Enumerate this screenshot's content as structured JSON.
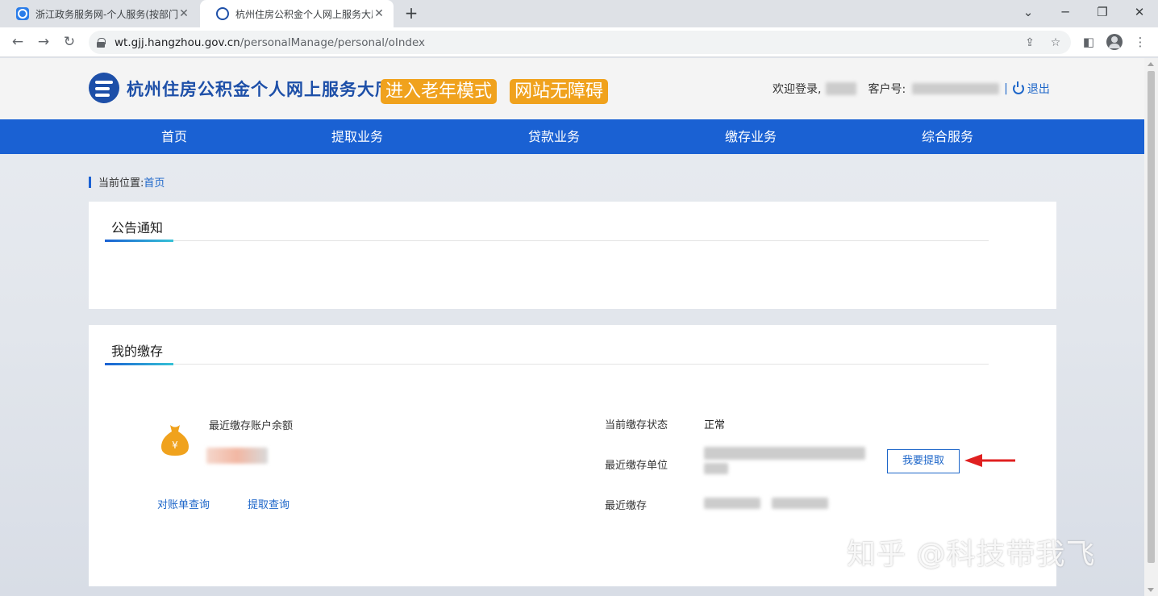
{
  "browser": {
    "tabs": [
      {
        "title": "浙江政务服务网-个人服务(按部门",
        "close": "✕"
      },
      {
        "title": "杭州住房公积金个人网上服务大厅",
        "close": "✕"
      }
    ],
    "new_tab": "+",
    "url_host": "wt.gjj.hangzhou.gov.cn",
    "url_path": "/personalManage/personal/oIndex",
    "window_controls": {
      "menu": "⌄",
      "minimize": "─",
      "restore": "❐",
      "close": "✕"
    }
  },
  "header": {
    "site_title": "杭州住房公积金个人网上服务大厅",
    "elder_mode": "进入老年模式",
    "accessible": "网站无障碍",
    "welcome": "欢迎登录,",
    "customer_no_label": "客户号:",
    "separator": "|",
    "logout": "退出"
  },
  "nav": {
    "items": [
      "首页",
      "提取业务",
      "贷款业务",
      "缴存业务",
      "综合服务"
    ]
  },
  "breadcrumb": {
    "prefix": "当前位置:",
    "current": "首页"
  },
  "notice": {
    "title": "公告通知"
  },
  "deposit": {
    "title": "我的缴存",
    "balance_label": "最近缴存账户余额",
    "link_statement": "对账单查询",
    "link_withdraw_query": "提取查询",
    "status_label": "当前缴存状态",
    "status_value": "正常",
    "unit_label": "最近缴存单位",
    "withdraw_button": "我要提取",
    "recent_label": "最近缴存"
  },
  "watermark": "知乎 @科技带我飞",
  "colors": {
    "nav_blue": "#1a61d3",
    "link_blue": "#1d66c9",
    "orange": "#f0a21d",
    "arrow_red": "#e02020"
  }
}
